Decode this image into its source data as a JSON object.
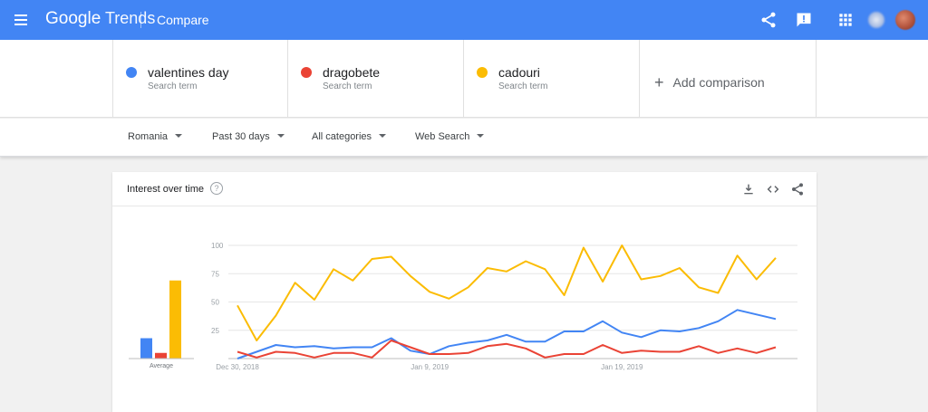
{
  "app": {
    "logo_google": "Google",
    "logo_trends": "Trends",
    "page_title": "Compare"
  },
  "toolbar_icons": [
    "share-icon",
    "feedback-icon",
    "apps-grid-icon"
  ],
  "terms": [
    {
      "name": "valentines day",
      "sub": "Search term",
      "color": "#4285f4"
    },
    {
      "name": "dragobete",
      "sub": "Search term",
      "color": "#ea4335"
    },
    {
      "name": "cadouri",
      "sub": "Search term",
      "color": "#fbbc04"
    }
  ],
  "add_comparison": "Add comparison",
  "filters": {
    "region": "Romania",
    "time": "Past 30 days",
    "category": "All categories",
    "type": "Web Search"
  },
  "card": {
    "title": "Interest over time",
    "help": "?"
  },
  "chart_data": {
    "type": "line",
    "ylim": [
      0,
      100
    ],
    "yticks": [
      "100",
      "75",
      "50",
      "25"
    ],
    "xtick_labels": [
      "Dec 30, 2018",
      "Jan 9, 2019",
      "Jan 19, 2019"
    ],
    "xtick_index": [
      0,
      10,
      20
    ],
    "average_label": "Average",
    "averages": [
      {
        "name": "valentines day",
        "value": 18
      },
      {
        "name": "dragobete",
        "value": 5
      },
      {
        "name": "cadouri",
        "value": 69
      }
    ],
    "series": [
      {
        "name": "valentines day",
        "color": "#4285f4",
        "values": [
          0,
          6,
          12,
          10,
          11,
          9,
          10,
          10,
          18,
          7,
          4,
          11,
          14,
          16,
          21,
          15,
          15,
          24,
          24,
          33,
          23,
          19,
          25,
          24,
          27,
          33,
          43,
          39,
          35
        ]
      },
      {
        "name": "dragobete",
        "color": "#ea4335",
        "values": [
          6,
          1,
          6,
          5,
          1,
          5,
          5,
          1,
          16,
          10,
          4,
          4,
          5,
          11,
          13,
          9,
          1,
          4,
          4,
          12,
          5,
          7,
          6,
          6,
          11,
          5,
          9,
          5,
          10
        ]
      },
      {
        "name": "cadouri",
        "color": "#fbbc04",
        "values": [
          47,
          16,
          38,
          67,
          52,
          79,
          69,
          88,
          90,
          73,
          59,
          53,
          63,
          80,
          77,
          86,
          79,
          56,
          98,
          68,
          100,
          70,
          73,
          80,
          63,
          58,
          91,
          70,
          89
        ]
      }
    ]
  }
}
